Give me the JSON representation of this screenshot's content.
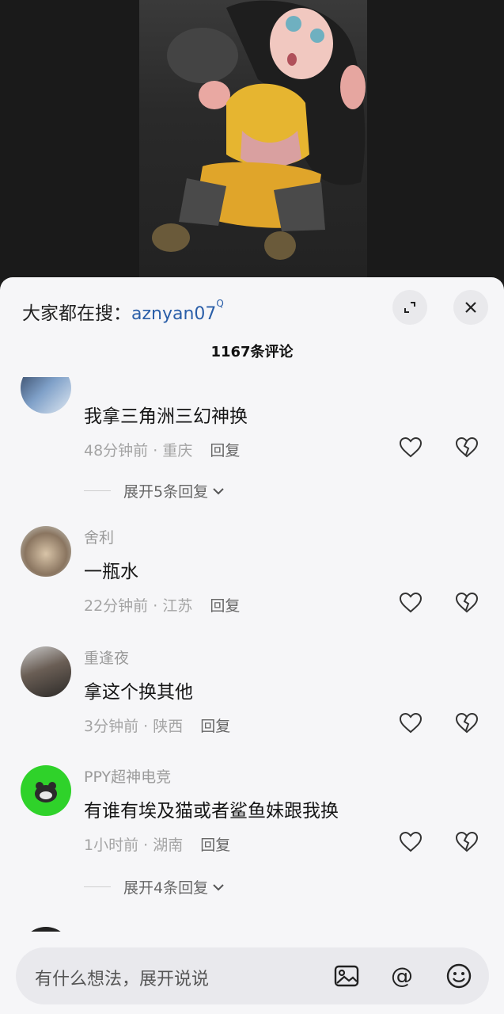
{
  "search": {
    "prefix": "大家都在搜：",
    "term": "aznyan07",
    "search_mark": "Q"
  },
  "comment_count": "1167条评论",
  "comments": [
    {
      "username": "",
      "content": "我拿三角洲三幻神换",
      "time": "48分钟前",
      "location": "重庆",
      "reply_label": "回复",
      "expand_label": "展开5条回复"
    },
    {
      "username": "舍利",
      "content": "一瓶水",
      "time": "22分钟前",
      "location": "江苏",
      "reply_label": "回复"
    },
    {
      "username": "重逢夜",
      "content": "拿这个换其他",
      "time": "3分钟前",
      "location": "陕西",
      "reply_label": "回复"
    },
    {
      "username": "PPY超神电竞",
      "content": "有谁有埃及猫或者鲨鱼妹跟我换",
      "time": "1小时前",
      "location": "湖南",
      "reply_label": "回复",
      "expand_label": "展开4条回复"
    }
  ],
  "input": {
    "placeholder": "有什么想法，展开说说"
  },
  "icons": [
    "expand-icon",
    "close-icon",
    "like-icon",
    "dislike-icon",
    "chevron-down-icon",
    "image-icon",
    "at-icon",
    "emoji-icon"
  ],
  "colors": {
    "sheet": "#f6f6f8",
    "link": "#2a5ea8",
    "green_avatar": "#2fd22a"
  }
}
